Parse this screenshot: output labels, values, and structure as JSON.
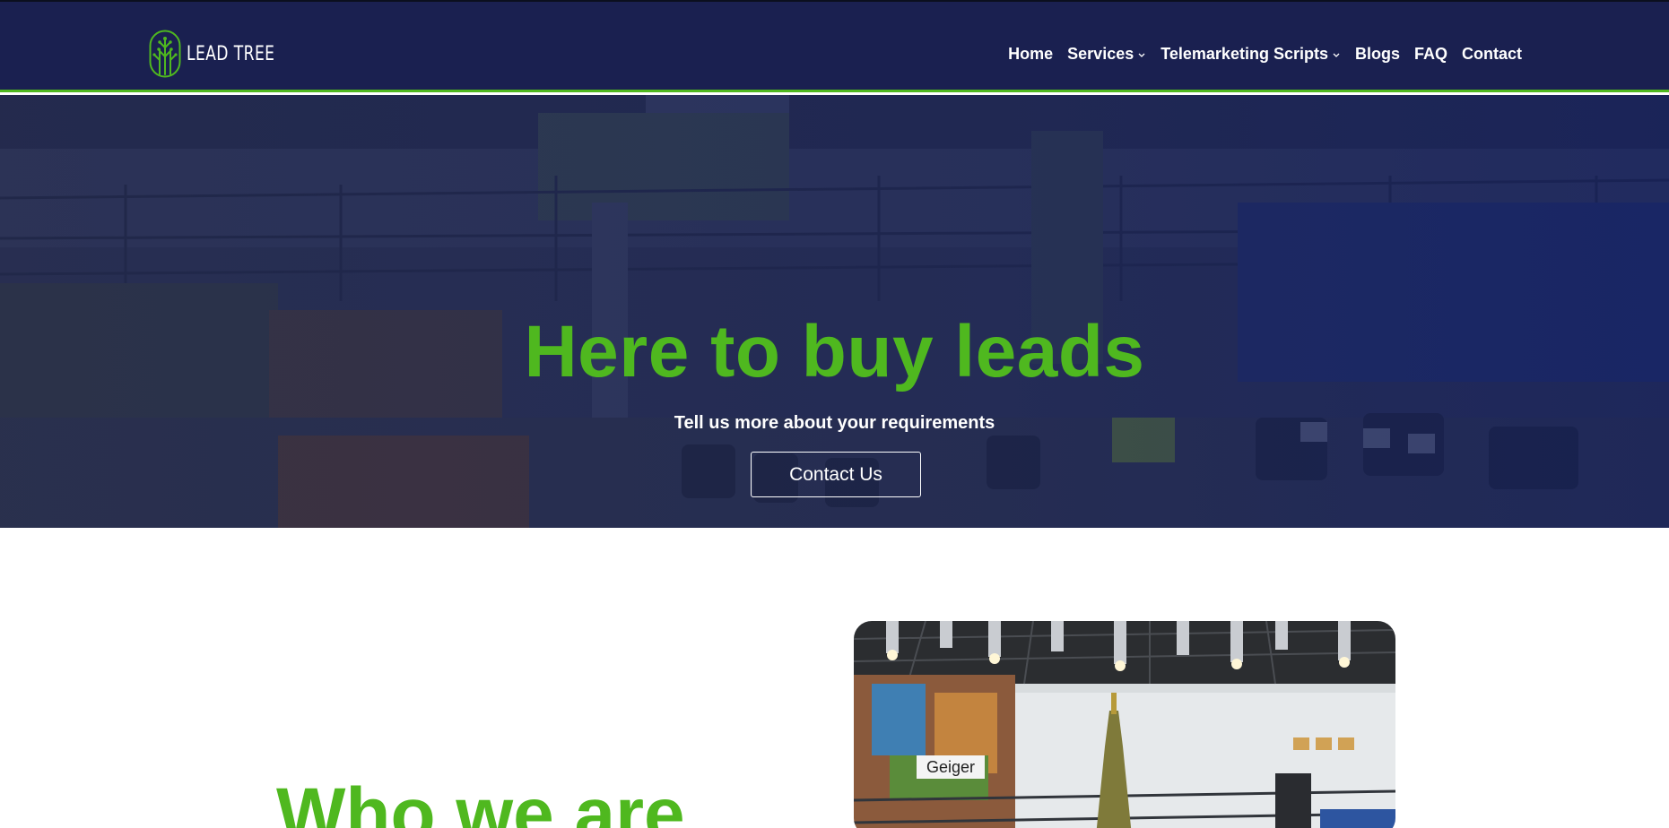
{
  "brand": {
    "name": "LEAD TREE",
    "logo_icon": "tree-icon",
    "accent_color": "#4fb81f",
    "header_color": "#1a2050"
  },
  "nav": {
    "items": [
      {
        "label": "Home",
        "has_dropdown": false
      },
      {
        "label": "Services",
        "has_dropdown": true
      },
      {
        "label": "Telemarketing Scripts",
        "has_dropdown": true
      },
      {
        "label": "Blogs",
        "has_dropdown": false
      },
      {
        "label": "FAQ",
        "has_dropdown": false
      },
      {
        "label": "Contact",
        "has_dropdown": false
      }
    ],
    "dropdown_icon": "chevron-down-icon"
  },
  "hero": {
    "title": "Here to buy leads",
    "subtitle": "Tell us more about your requirements",
    "cta_label": "Contact Us"
  },
  "about": {
    "title": "Who we are",
    "photo_sign": "Geiger"
  }
}
